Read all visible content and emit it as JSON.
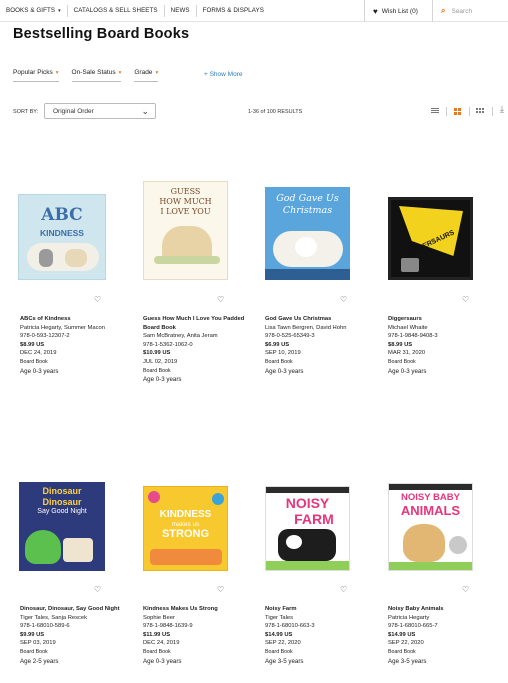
{
  "nav": {
    "items": [
      {
        "label": "BOOKS & GIFTS",
        "caret": true
      },
      {
        "label": "CATALOGS & SELL SHEETS",
        "caret": false
      },
      {
        "label": "NEWS",
        "caret": false
      },
      {
        "label": "FORMS & DISPLAYS",
        "caret": false
      }
    ],
    "wishlist": "Wish List (0)",
    "search_placeholder": "Search"
  },
  "page": {
    "title": "Bestselling Board Books"
  },
  "filters": {
    "items": [
      "Popular Picks",
      "On-Sale Status",
      "Grade"
    ],
    "show_more": "+ Show More"
  },
  "sort": {
    "label": "SORT BY:",
    "selected": "Original Order",
    "results": "1-36 of 100 RESULTS"
  },
  "products": [
    {
      "title": "ABCs of Kindness",
      "author": "Patricia Hegarty, Summer Macon",
      "isbn": "978-0-593-12307-2",
      "price": "$8.99 US",
      "date": "DEC 24, 2019",
      "format": "Board Book",
      "age": "Age 0-3 years",
      "cover_text": [
        "ABC",
        "KINDNESS"
      ]
    },
    {
      "title": "Guess How Much I Love You Padded Board Book",
      "author": "Sam McBratney, Anita Jeram",
      "isbn": "978-1-5362-1062-0",
      "price": "$10.99 US",
      "date": "JUL 02, 2019",
      "format": "Board Book",
      "age": "Age 0-3 years",
      "cover_text": [
        "GUESS",
        "HOW MUCH",
        "I LOVE YOU"
      ]
    },
    {
      "title": "God Gave Us Christmas",
      "author": "Lisa Tawn Bergren, David Hohn",
      "isbn": "978-0-525-65349-3",
      "price": "$6.99 US",
      "date": "SEP 10, 2019",
      "format": "Board Book",
      "age": "Age 0-3 years",
      "cover_text": [
        "God Gave Us",
        "Christmas"
      ]
    },
    {
      "title": "Diggersaurs",
      "author": "Michael Whaite",
      "isbn": "978-1-9848-9408-3",
      "price": "$8.99 US",
      "date": "MAR 31, 2020",
      "format": "Board Book",
      "age": "Age 0-3 years",
      "cover_text": [
        "DIGGERSAURS"
      ]
    },
    {
      "title": "Dinosaur, Dinosaur, Say Good Night",
      "author": "Tiger Tales, Sanja Rescek",
      "isbn": "978-1-68010-589-6",
      "price": "$9.99 US",
      "date": "SEP 03, 2019",
      "format": "Board Book",
      "age": "Age 2-5 years",
      "cover_text": [
        "Dinosaur",
        "Dinosaur",
        "Say Good Night"
      ]
    },
    {
      "title": "Kindness Makes Us Strong",
      "author": "Sophie Beer",
      "isbn": "978-1-9848-1639-9",
      "price": "$11.99 US",
      "date": "DEC 24, 2019",
      "format": "Board Book",
      "age": "Age 0-3 years",
      "cover_text": [
        "KINDNESS",
        "makes us",
        "STRONG"
      ]
    },
    {
      "title": "Noisy Farm",
      "author": "Tiger Tales",
      "isbn": "978-1-68010-663-3",
      "price": "$14.99 US",
      "date": "SEP 22, 2020",
      "format": "Board Book",
      "age": "Age 3-5 years",
      "cover_text": [
        "NOISY",
        "FARM"
      ]
    },
    {
      "title": "Noisy Baby Animals",
      "author": "Patricia Hegarty",
      "isbn": "978-1-68010-665-7",
      "price": "$14.99 US",
      "date": "SEP 22, 2020",
      "format": "Board Book",
      "age": "Age 3-5 years",
      "cover_text": [
        "NOISY BABY",
        "ANIMALS"
      ]
    }
  ],
  "colors": {
    "accent": "#e87722",
    "link": "#2e7bbf"
  }
}
